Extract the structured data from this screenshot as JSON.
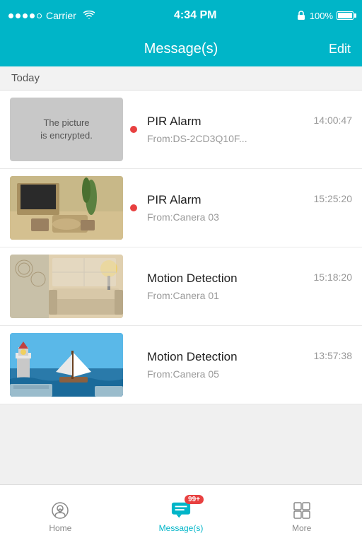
{
  "statusBar": {
    "carrier": "Carrier",
    "time": "4:34 PM",
    "battery": "100%"
  },
  "header": {
    "title": "Message(s)",
    "editLabel": "Edit"
  },
  "section": {
    "todayLabel": "Today"
  },
  "messages": [
    {
      "id": 1,
      "thumbnail": "encrypted",
      "encryptedText": "The picture\nis encrypted.",
      "title": "PIR Alarm",
      "time": "14:00:47",
      "from": "From:DS-2CD3Q10F...",
      "unread": true
    },
    {
      "id": 2,
      "thumbnail": "living-room",
      "title": "PIR Alarm",
      "time": "15:25:20",
      "from": "From:Canera 03",
      "unread": true
    },
    {
      "id": 3,
      "thumbnail": "interior",
      "title": "Motion Detection",
      "time": "15:18:20",
      "from": "From:Canera 01",
      "unread": false
    },
    {
      "id": 4,
      "thumbnail": "sailing",
      "title": "Motion Detection",
      "time": "13:57:38",
      "from": "From:Canera 05",
      "unread": false
    }
  ],
  "tabBar": {
    "homeLabel": "Home",
    "messagesLabel": "Message(s)",
    "moreLabel": "More",
    "badgeCount": "99+"
  }
}
